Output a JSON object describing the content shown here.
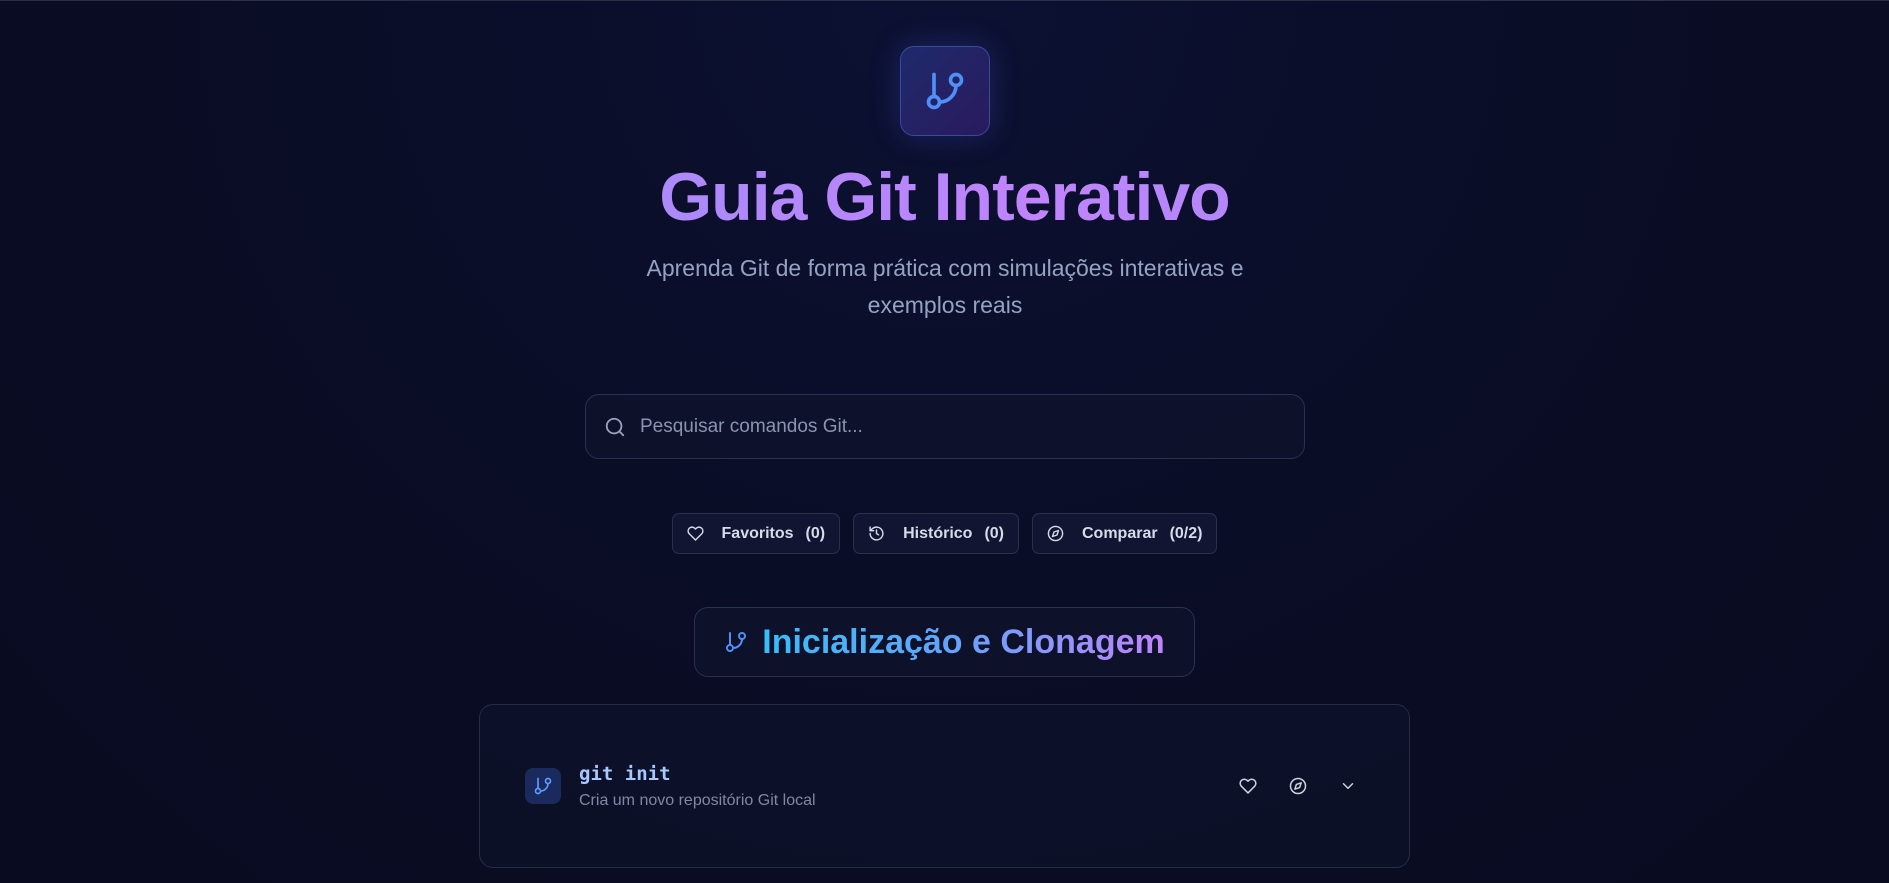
{
  "header": {
    "logo_icon": "git-branch-icon",
    "title": "Guia Git Interativo",
    "subtitle": "Aprenda Git de forma prática com simulações interativas e exemplos reais"
  },
  "search": {
    "icon": "search-icon",
    "placeholder": "Pesquisar comandos Git..."
  },
  "chips": [
    {
      "icon": "heart-icon",
      "label": "Favoritos",
      "count": "(0)"
    },
    {
      "icon": "history-icon",
      "label": "Histórico",
      "count": "(0)"
    },
    {
      "icon": "compass-icon",
      "label": "Comparar",
      "count": "(0/2)"
    }
  ],
  "section": {
    "icon": "git-branch-icon",
    "title": "Inicialização e Clonagem"
  },
  "commands": [
    {
      "icon": "git-branch-icon",
      "name": "git init",
      "description": "Cria um novo repositório Git local"
    }
  ],
  "colors": {
    "background": "#0a0d26",
    "accent_blue": "#60a5fa",
    "accent_purple": "#c084fc"
  }
}
